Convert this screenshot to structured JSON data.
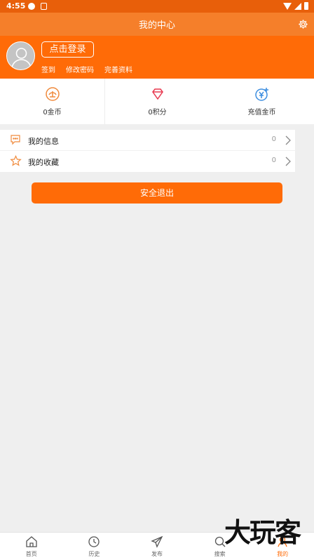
{
  "status_bar": {
    "time": "4:55"
  },
  "app_bar": {
    "title": "我的中心",
    "settings_icon": "gear-icon"
  },
  "profile": {
    "login_label": "点击登录",
    "links": [
      "签到",
      "修改密码",
      "完善资料"
    ]
  },
  "stats": [
    {
      "label": "0金币",
      "icon": "coin-icon"
    },
    {
      "label": "0积分",
      "icon": "diamond-icon"
    },
    {
      "label": "充值金币",
      "icon": "recharge-icon"
    }
  ],
  "list": [
    {
      "label": "我的信息",
      "count": "0",
      "icon": "message-icon"
    },
    {
      "label": "我的收藏",
      "count": "0",
      "icon": "star-icon"
    }
  ],
  "logout_label": "安全退出",
  "tabs": [
    {
      "label": "首页",
      "icon": "home-icon",
      "active": false
    },
    {
      "label": "历史",
      "icon": "clock-icon",
      "active": false
    },
    {
      "label": "发布",
      "icon": "send-icon",
      "active": false
    },
    {
      "label": "搜索",
      "icon": "search-icon",
      "active": false
    },
    {
      "label": "我的",
      "icon": "user-icon",
      "active": true
    }
  ],
  "watermark": "大玩客",
  "colors": {
    "accent": "#ff6b07",
    "header": "#f57f2a",
    "status": "#e85f0a"
  }
}
